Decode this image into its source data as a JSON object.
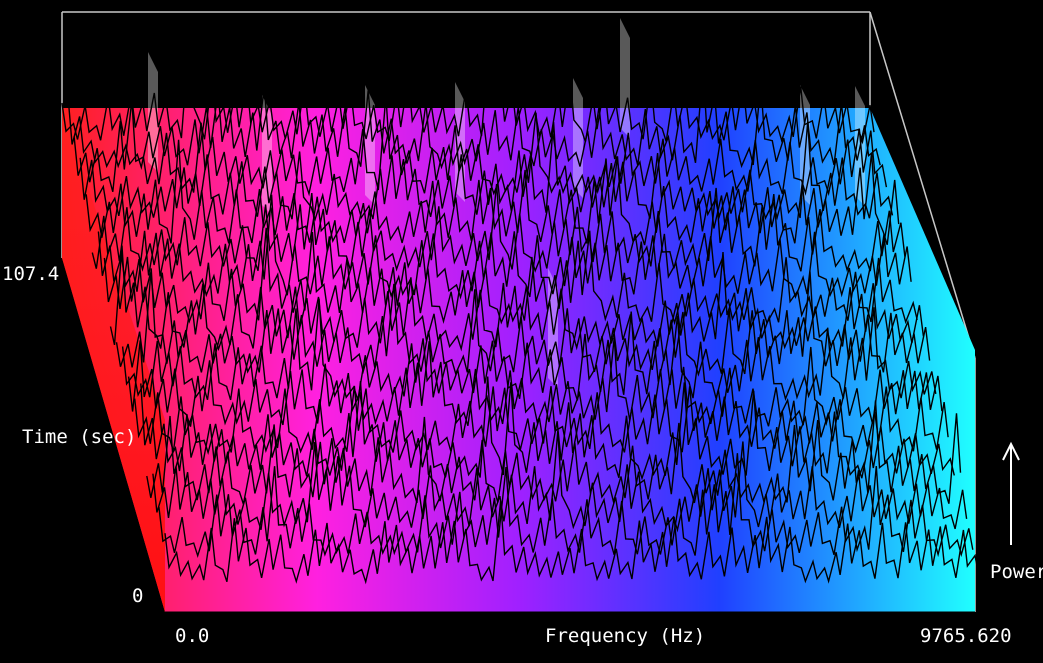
{
  "chart_data": {
    "type": "area",
    "title": "",
    "xlabel": "Frequency (Hz)",
    "ylabel": "Time (sec)",
    "zlabel": "Power",
    "xlim": [
      0.0,
      9765.62
    ],
    "ylim": [
      0,
      107.4
    ],
    "x_tick_labels": [
      "0.0",
      "9765.620"
    ],
    "y_tick_labels": [
      "0",
      "107.4"
    ],
    "colors": {
      "low_frequency": "#ff2020",
      "mid_low_frequency": "#ff20e0",
      "mid_frequency": "#a020ff",
      "mid_high_frequency": "#2040ff",
      "high_frequency": "#20ffff",
      "frame": "#c8c8c8",
      "text": "#ffffff"
    }
  }
}
